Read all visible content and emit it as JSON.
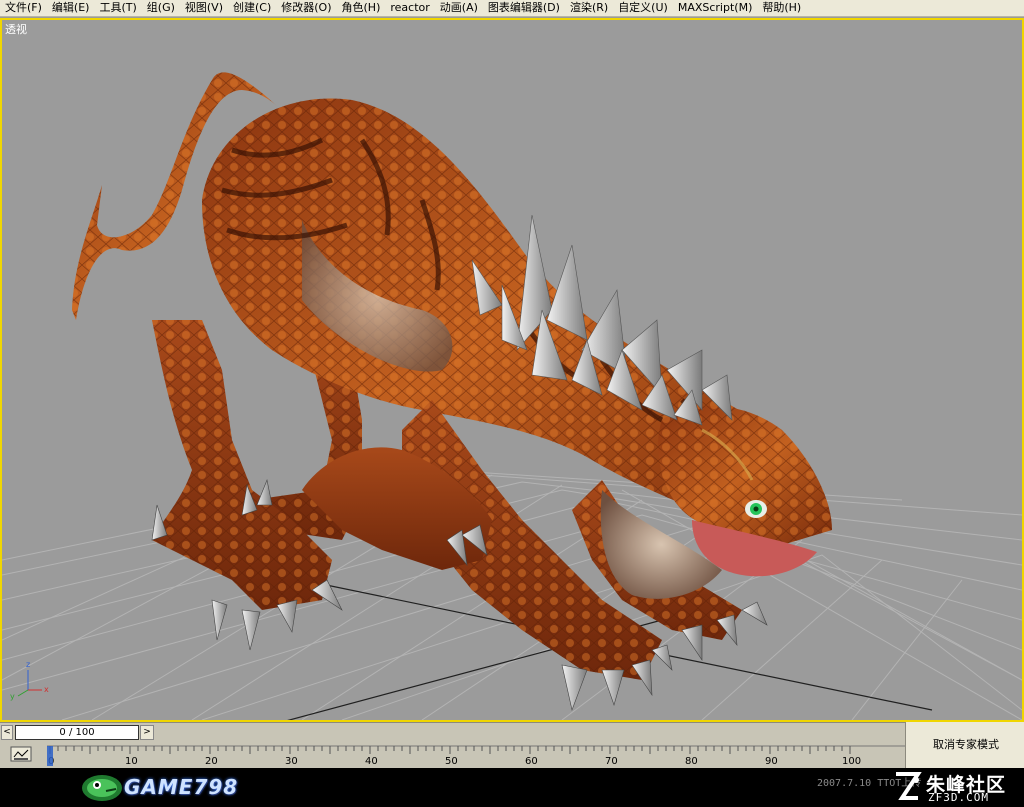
{
  "menu": [
    "文件(F)",
    "编辑(E)",
    "工具(T)",
    "组(G)",
    "视图(V)",
    "创建(C)",
    "修改器(O)",
    "角色(H)",
    "reactor",
    "动画(A)",
    "图表编辑器(D)",
    "渲染(R)",
    "自定义(U)",
    "MAXScript(M)",
    "帮助(H)"
  ],
  "viewport": {
    "label": "透视",
    "border_color": "#f0d600",
    "background": "#9b9b9b",
    "subject": "orange scaled lizard-like creature with grey spikes on its back",
    "gizmo_axes": [
      "x",
      "y",
      "z"
    ]
  },
  "time_slider": {
    "left_arrow": "<",
    "right_arrow": ">",
    "display": "0 / 100",
    "current_frame": 0,
    "total_frames": 100
  },
  "track_bar": {
    "tick_labels": [
      "0",
      "10",
      "20",
      "30",
      "40",
      "50",
      "60",
      "70",
      "80",
      "90",
      "100"
    ]
  },
  "expert_mode_button": "取消专家模式",
  "banner": {
    "game_logo": "GAME798",
    "date_text": "2007.7.10 TTOT上传",
    "site_name": "朱峰社区",
    "site_domain": "ZF3D.COM"
  },
  "colors": {
    "menubar": "#ece9d8",
    "creature_orange": "#b5521a",
    "spikes": "#d8d8d8",
    "eye": "#25c45a"
  }
}
